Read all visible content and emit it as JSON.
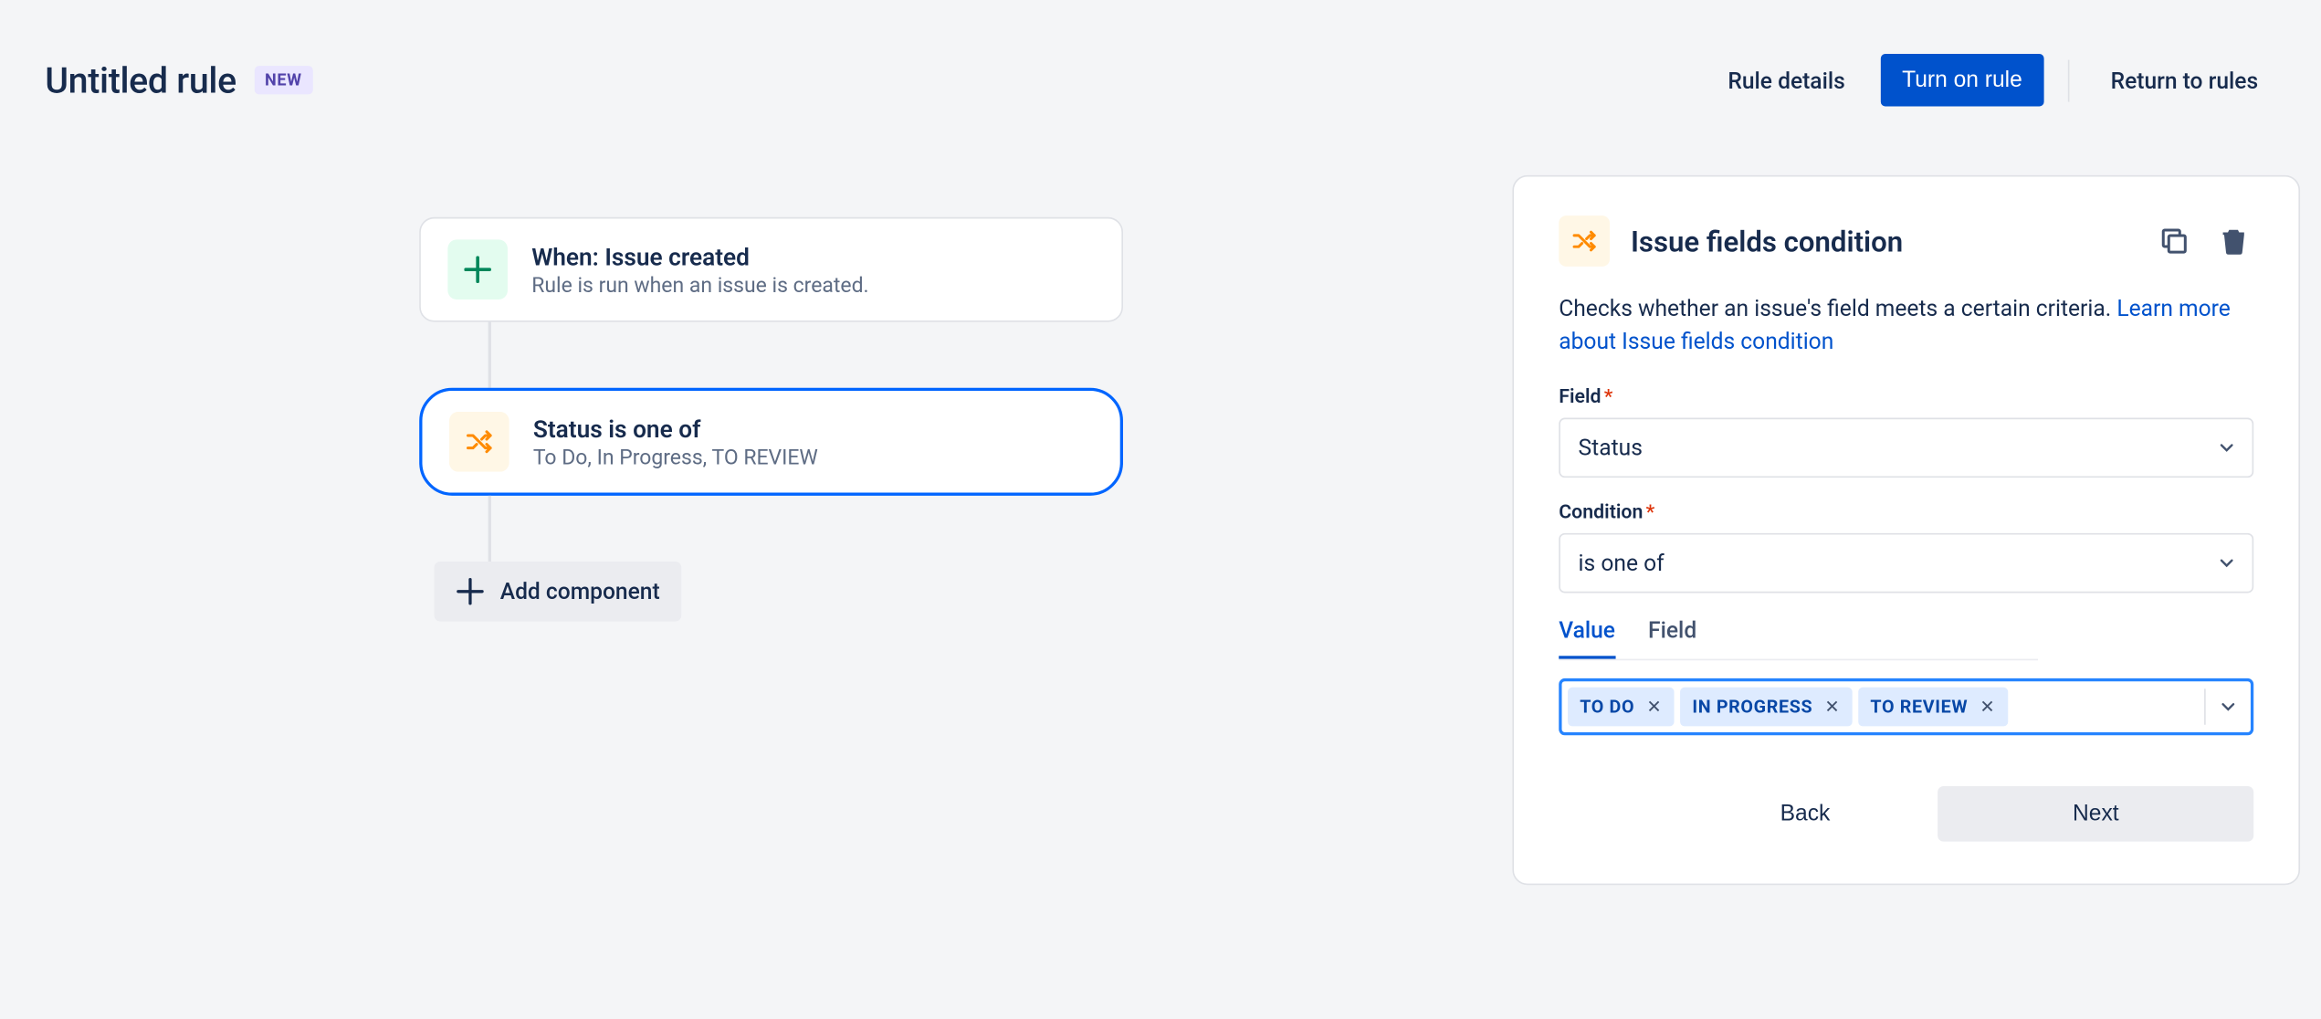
{
  "header": {
    "title": "Untitled rule",
    "badge": "NEW",
    "rule_details": "Rule details",
    "turn_on": "Turn on rule",
    "return": "Return to rules"
  },
  "flow": {
    "trigger": {
      "title": "When: Issue created",
      "subtitle": "Rule is run when an issue is created."
    },
    "condition": {
      "title": "Status is one of",
      "subtitle": "To Do, In Progress, TO REVIEW"
    },
    "add_component": "Add component"
  },
  "panel": {
    "title": "Issue fields condition",
    "description_prefix": "Checks whether an issue's field meets a certain criteria. ",
    "learn_more": "Learn more about Issue fields condition",
    "field_label": "Field",
    "field_value": "Status",
    "condition_label": "Condition",
    "condition_value": "is one of",
    "tab_value": "Value",
    "tab_field": "Field",
    "chips": [
      "TO DO",
      "IN PROGRESS",
      "TO REVIEW"
    ],
    "back": "Back",
    "next": "Next"
  }
}
